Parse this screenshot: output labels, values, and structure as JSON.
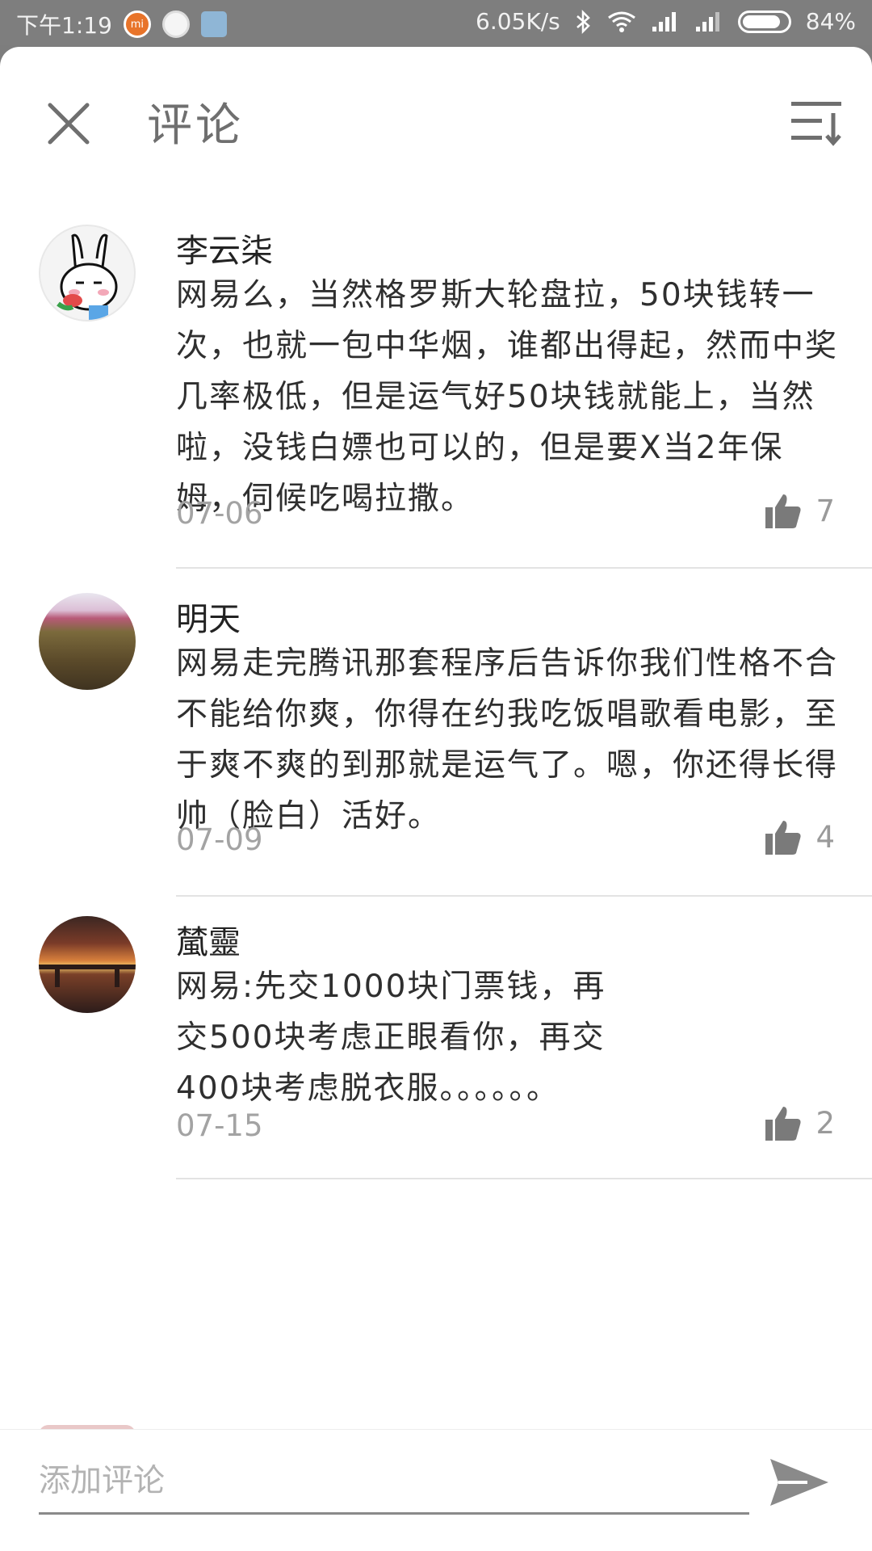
{
  "status_bar": {
    "time": "下午1:19",
    "mi_label": "mi",
    "speed": "6.05K/s",
    "battery": "84%"
  },
  "header": {
    "title": "评论"
  },
  "comments": [
    {
      "name": "李云柒",
      "text": "网易么，当然格罗斯大轮盘拉，50块钱转一次，也就一包中华烟，谁都出得起，然而中奖几率极低，但是运气好50块钱就能上，当然啦，没钱白嫖也可以的，但是要X当2年保姆，伺候吃喝拉撒。",
      "date": "07-06",
      "likes": "7"
    },
    {
      "name": "明天",
      "text": "网易走完腾讯那套程序后告诉你我们性格不合不能给你爽，你得在约我吃饭唱歌看电影，至于爽不爽的到那就是运气了。嗯，你还得长得帅（脸白）活好。",
      "date": "07-09",
      "likes": "4"
    },
    {
      "name": "檒靈",
      "text": "网易:先交1000块门票钱，再交500块考虑正眼看你，再交400块考虑脱衣服。。。。。。",
      "date": "07-15",
      "likes": "2"
    }
  ],
  "composer": {
    "placeholder": "添加评论"
  },
  "icons": {
    "close": "close-icon",
    "sort": "sort-icon",
    "like": "thumbs-up-icon",
    "send": "send-icon"
  },
  "colors": {
    "status_bar": "#7e7e7e",
    "icon_gray": "#6f6f6f",
    "secondary_text": "#a3a3a3"
  }
}
